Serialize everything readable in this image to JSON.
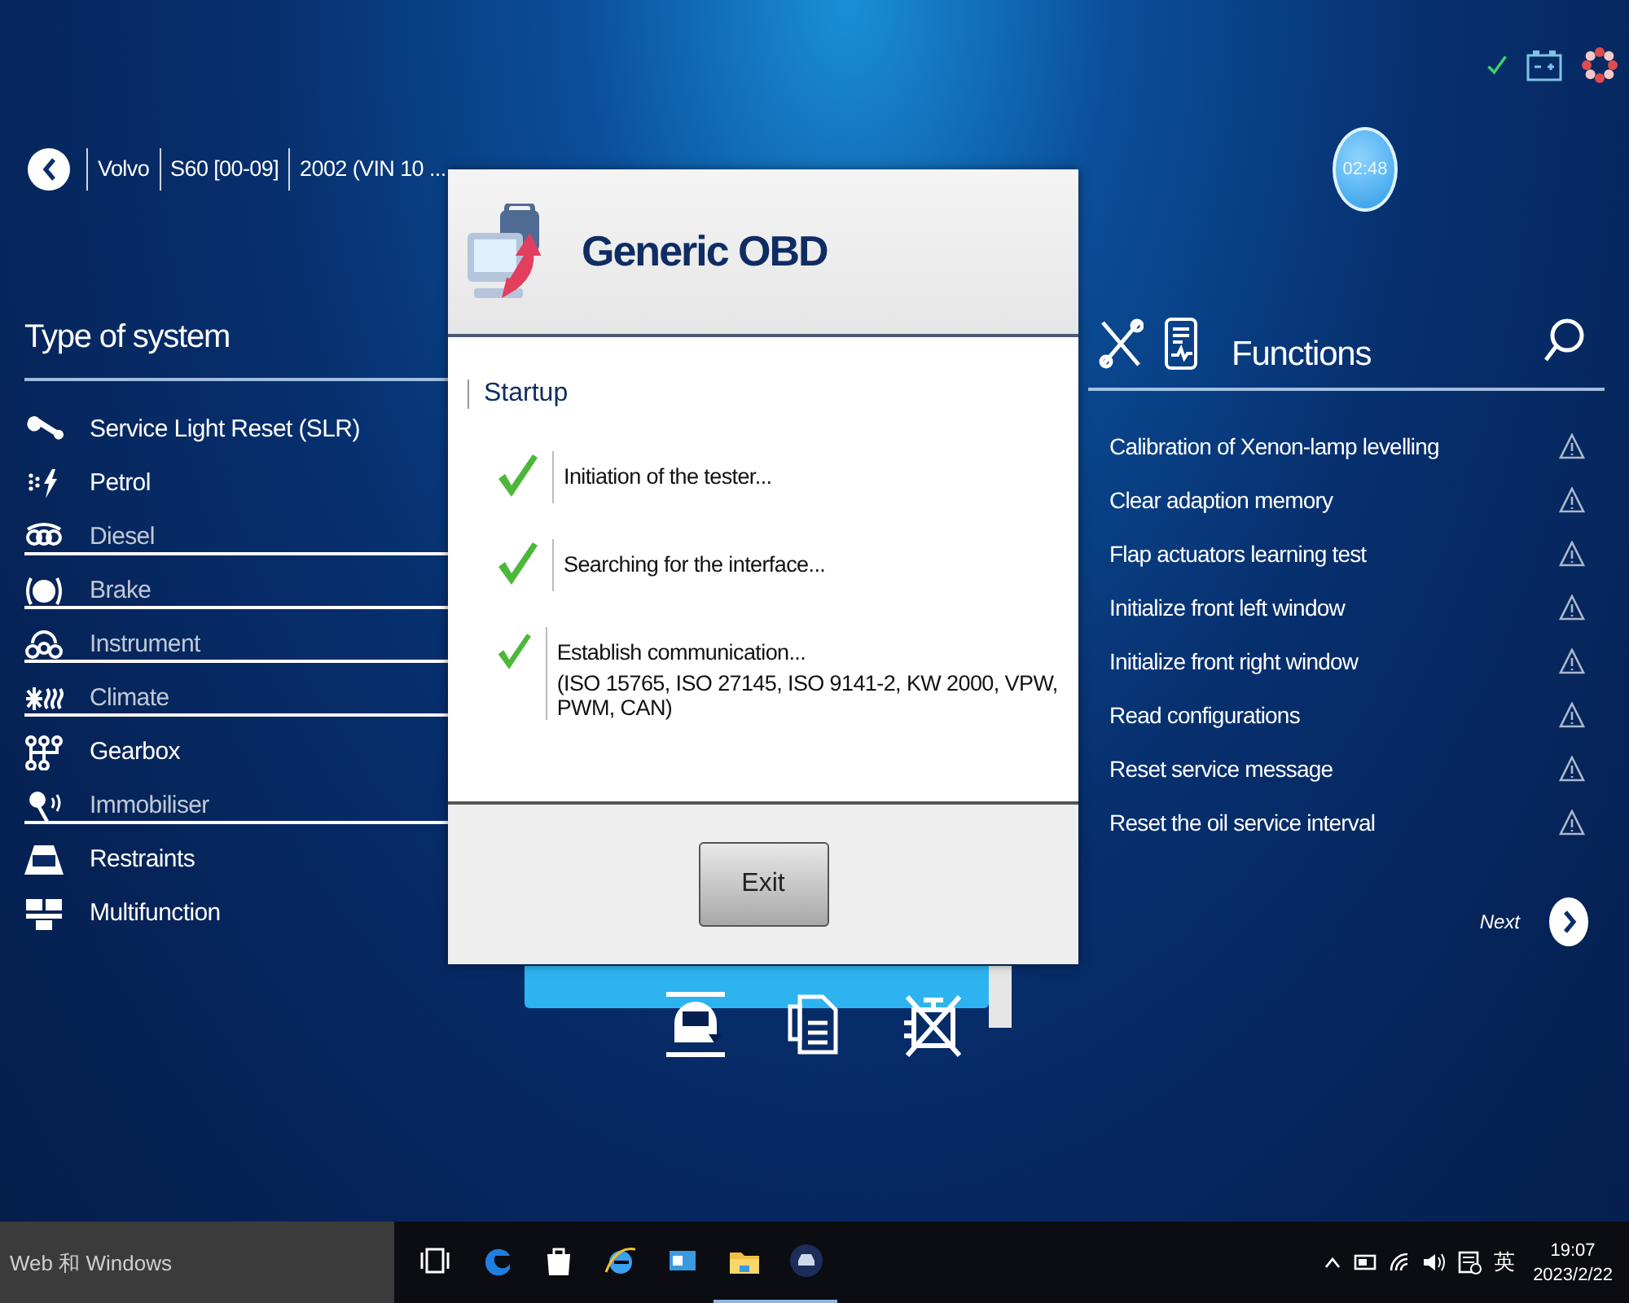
{
  "breadcrumb": [
    {
      "label": "Volvo",
      "active": true
    },
    {
      "label": "S60 [00-09]",
      "active": true
    },
    {
      "label": "2002 (VIN 10 ...",
      "active": true
    }
  ],
  "timer": "02:48",
  "system_panel": {
    "title": "Type of system",
    "items": [
      {
        "label": "Service Light Reset (SLR)",
        "struck": false
      },
      {
        "label": "Petrol",
        "struck": false
      },
      {
        "label": "Diesel",
        "struck": true
      },
      {
        "label": "Brake",
        "struck": true
      },
      {
        "label": "Instrument",
        "struck": true
      },
      {
        "label": "Climate",
        "struck": true
      },
      {
        "label": "Gearbox",
        "struck": false
      },
      {
        "label": "Immobiliser",
        "struck": true
      },
      {
        "label": "Restraints",
        "struck": false
      },
      {
        "label": "Multifunction",
        "struck": false
      }
    ]
  },
  "functions_panel": {
    "title": "Functions",
    "items": [
      "Calibration of Xenon-lamp levelling",
      "Clear adaption memory",
      "Flap actuators learning test",
      "Initialize front left window",
      "Initialize front right window",
      "Read configurations",
      "Reset service message",
      "Reset the oil service interval"
    ],
    "next": "Next"
  },
  "dialog": {
    "title": "Generic OBD",
    "section": "Startup",
    "steps": [
      {
        "text": "Initiation of the tester...",
        "done": true
      },
      {
        "text": "Searching for the interface...",
        "done": true
      },
      {
        "text": "Establish communication...",
        "detail": "(ISO 15765, ISO 27145, ISO 9141-2, KW 2000, VPW, PWM, CAN)",
        "done": true
      }
    ],
    "button": "Exit"
  },
  "taskbar": {
    "search": {
      "placeholder": "Web 和 Windows"
    },
    "apps": [
      {
        "kind": "task-view",
        "running": false
      },
      {
        "kind": "edge",
        "running": false
      },
      {
        "kind": "store",
        "running": false
      },
      {
        "kind": "ie",
        "running": false
      },
      {
        "kind": "mail",
        "running": false
      },
      {
        "kind": "folder",
        "running": true
      },
      {
        "kind": "car",
        "running": true
      }
    ],
    "ime": "英",
    "time": "19:07",
    "date": "2023/2/22"
  }
}
